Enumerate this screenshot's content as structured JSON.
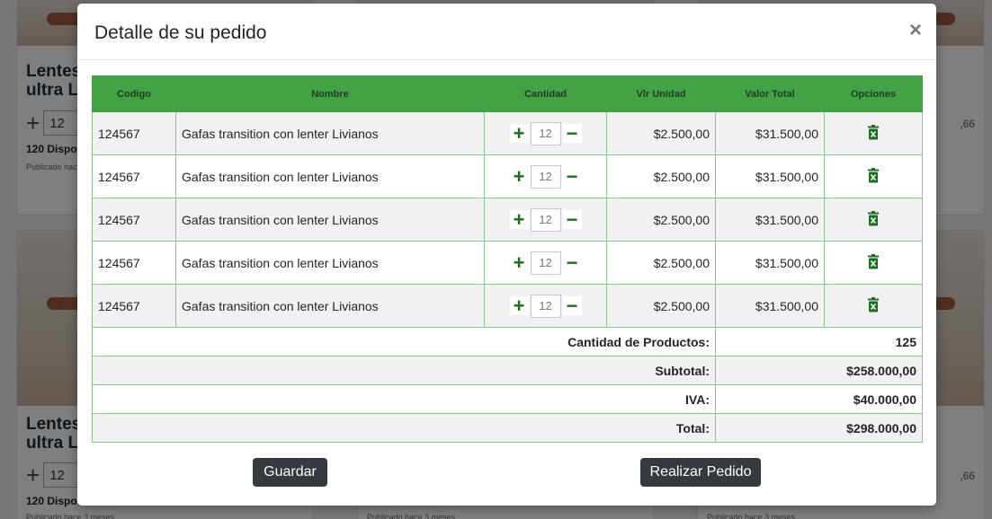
{
  "background": {
    "card_title": "Lentes ultra L",
    "card_qty": "12",
    "card_available": "120 Dispo",
    "card_published": "Publicado hace 3 meses",
    "card_price_fragment": ",66"
  },
  "modal": {
    "title": "Detalle de su pedido",
    "close_glyph": "×",
    "columns": [
      "Codigo",
      "Nombre",
      "Cantidad",
      "Vlr Unidad",
      "Valor Total",
      "Opciones"
    ],
    "rows": [
      {
        "code": "124567",
        "name": "Gafas transition con lenter Livianos",
        "qty": "12",
        "unit": "$2.500,00",
        "total": "$31.500,00"
      },
      {
        "code": "124567",
        "name": "Gafas transition con lenter Livianos",
        "qty": "12",
        "unit": "$2.500,00",
        "total": "$31.500,00"
      },
      {
        "code": "124567",
        "name": "Gafas transition con lenter Livianos",
        "qty": "12",
        "unit": "$2.500,00",
        "total": "$31.500,00"
      },
      {
        "code": "124567",
        "name": "Gafas transition con lenter Livianos",
        "qty": "12",
        "unit": "$2.500,00",
        "total": "$31.500,00"
      },
      {
        "code": "124567",
        "name": "Gafas transition con lenter Livianos",
        "qty": "12",
        "unit": "$2.500,00",
        "total": "$31.500,00"
      }
    ],
    "summary": {
      "products_label": "Cantidad de Productos:",
      "products_value": "125",
      "subtotal_label": "Subtotal:",
      "subtotal_value": "$258.000,00",
      "iva_label": "IVA:",
      "iva_value": "$40.000,00",
      "total_label": "Total:",
      "total_value": "$298.000,00"
    },
    "buttons": {
      "save": "Guardar",
      "order": "Realizar Pedido"
    },
    "icons": {
      "plus": "plus-icon",
      "minus": "minus-icon",
      "delete": "trash-icon"
    },
    "colors": {
      "header_green": "#43a146",
      "icon_green": "#1e6b22",
      "button_dark": "#343a40"
    }
  }
}
